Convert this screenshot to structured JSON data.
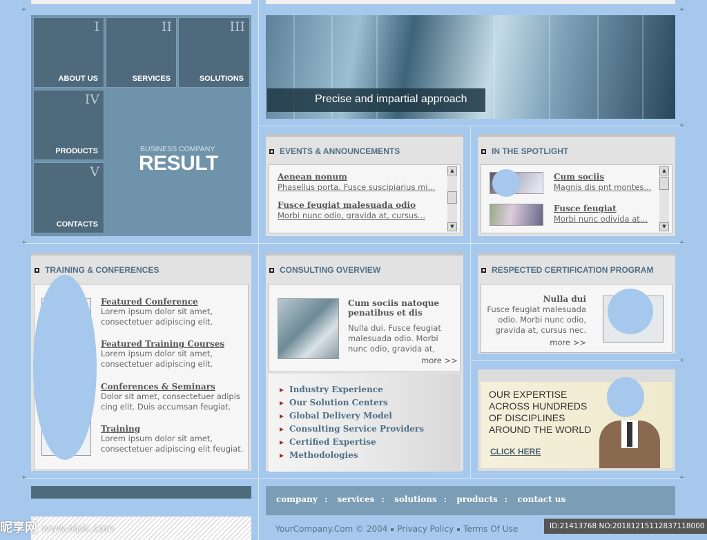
{
  "nav": {
    "tiles": [
      {
        "num": "I",
        "label": "ABOUT US"
      },
      {
        "num": "II",
        "label": "SERVICES"
      },
      {
        "num": "III",
        "label": "SOLUTIONS"
      },
      {
        "num": "IV",
        "label": "PRODUCTS"
      },
      {
        "num": "V",
        "label": "CONTACTS"
      }
    ],
    "brand_small": "BUSINESS COMPANY",
    "brand_big": "RESULT"
  },
  "hero": {
    "caption": "Precise and impartial approach"
  },
  "events": {
    "title": "EVENTS & ANNOUNCEMENTS",
    "items": [
      {
        "title": "Aenean nonum",
        "text": "Phasellus porta. Fusce suscipiarius mi..."
      },
      {
        "title": "Fusce feugiat malesuada odio",
        "text": "Morbi nunc odio, gravida at, cursus..."
      }
    ]
  },
  "spotlight": {
    "title": "IN THE SPOTLIGHT",
    "items": [
      {
        "title": "Cum sociis",
        "text": "Magnis dis pnt montes..."
      },
      {
        "title": "Fusce feugiat",
        "text": "Morbi nunc odivida at..."
      }
    ]
  },
  "training": {
    "title": "TRAINING & CONFERENCES",
    "items": [
      {
        "title": "Featured Conference",
        "line1": "Lorem ipsum dolor sit amet,",
        "line2": "consectetuer adipiscing elit."
      },
      {
        "title": "Featured Training Courses",
        "line1": "Lorem ipsum dolor sit amet,",
        "line2": "consectetuer adipiscing elit."
      },
      {
        "title": "Conferences & Seminars",
        "line1": "Dolor sit amet, consectetuer adipis",
        "line2": "cing elit. Duis accumsan feugiat."
      },
      {
        "title": "Training",
        "line1": "Lorem ipsum dolor sit amet,",
        "line2": "consectetuer adipiscing elit feugiat."
      }
    ]
  },
  "consulting": {
    "title": "CONSULTING OVERVIEW",
    "heading1": "Cum sociis natoque",
    "heading2": "penatibus et dis",
    "line1": "Nulla dui. Fusce feugiat",
    "line2": "malesuada odio. Morbi",
    "line3": "nunc odio, gravida at,",
    "more": "more >>",
    "menu": [
      "Industry Experience",
      "Our Solution Centers",
      "Global Delivery Model",
      "Consulting Service Providers",
      "Certified Expertise",
      "Methodologies"
    ]
  },
  "certification": {
    "title": "RESPECTED CERTIFICATION PROGRAM",
    "heading": "Nulla dui",
    "line1": "Fusce feugiat malesuada",
    "line2": "odio. Morbi nunc odio,",
    "line3": "gravida at, cursus nec.",
    "more": "more >>"
  },
  "expertise": {
    "line1": "OUR EXPERTISE",
    "line2": "ACROSS HUNDREDS",
    "line3": "OF DISCIPLINES",
    "line4": "AROUND THE WORLD",
    "cta": "CLICK HERE"
  },
  "footer": {
    "links": [
      "company",
      "services",
      "solutions",
      "products",
      "contact us"
    ],
    "separator": ":",
    "copyright": "YourCompany.Com © 2004",
    "privacy": "Privacy Policy",
    "terms": "Terms Of Use"
  },
  "watermark": {
    "logo": "昵享网",
    "site": "www.nipic.com",
    "id": "ID:21413768 NO:20181215112837118000"
  }
}
